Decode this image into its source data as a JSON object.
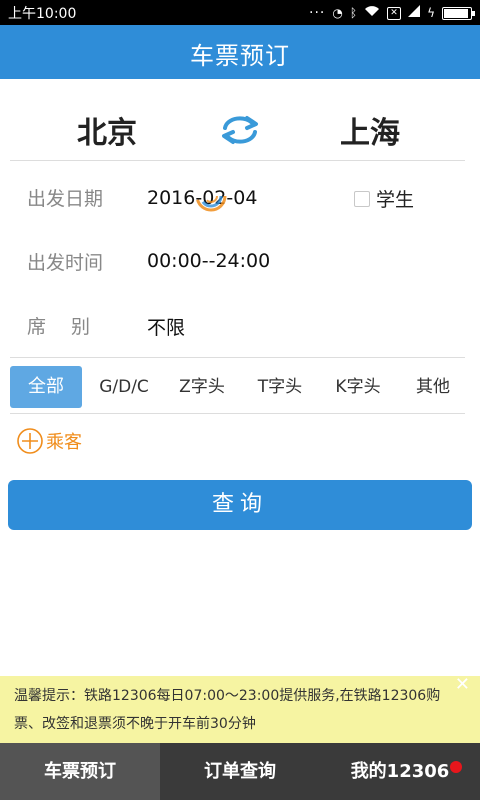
{
  "status_bar": {
    "time": "上午10:00",
    "icons": [
      "more-dots-icon",
      "alarm-icon",
      "bluetooth-icon",
      "wifi-icon",
      "sim-icon",
      "signal-icon",
      "charging-icon",
      "battery-icon"
    ]
  },
  "header": {
    "title": "车票预订",
    "color": "#2f8dd8"
  },
  "route": {
    "from": "北京",
    "to": "上海"
  },
  "form": {
    "date_label": "出发日期",
    "date_value": "2016-02-04",
    "student_label": "学生",
    "student_checked": false,
    "time_label": "出发时间",
    "time_value": "00:00--24:00",
    "seat_label": "席　 别",
    "seat_value": "不限"
  },
  "train_types": {
    "selected": "全部",
    "items": [
      "全部",
      "G/D/C",
      "Z字头",
      "T字头",
      "K字头",
      "其他"
    ]
  },
  "passenger": {
    "add_label": "乘客"
  },
  "search_button": {
    "label": "查询"
  },
  "notice": {
    "text": "温馨提示：铁路12306每日07:00～23:00提供服务,在铁路12306购票、改签和退票须不晚于开车前30分钟",
    "close": "✕"
  },
  "bottom_nav": {
    "items": [
      "车票预订",
      "订单查询",
      "我的12306"
    ],
    "active": "车票预订",
    "badge_color": "#e8161c"
  }
}
